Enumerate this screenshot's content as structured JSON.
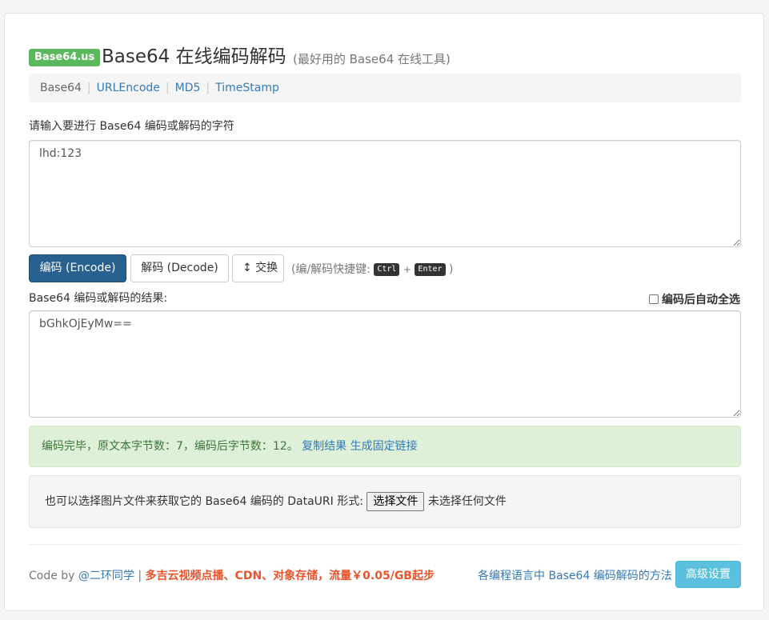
{
  "brand": "Base64.us",
  "title": "Base64 在线编码解码",
  "subtitle": "(最好用的 Base64 在线工具)",
  "nav": {
    "items": [
      {
        "label": "Base64",
        "active": true
      },
      {
        "label": "URLEncode",
        "active": false
      },
      {
        "label": "MD5",
        "active": false
      },
      {
        "label": "TimeStamp",
        "active": false
      }
    ],
    "separator": "|"
  },
  "input": {
    "label": "请输入要进行 Base64 编码或解码的字符",
    "value": "lhd:123"
  },
  "buttons": {
    "encode": "编码 (Encode)",
    "decode": "解码 (Decode)",
    "swap": "↕ 交换"
  },
  "shortcut": {
    "prefix": "(编/解码快捷键:",
    "key1": "Ctrl",
    "plus": "+",
    "key2": "Enter",
    "suffix": ")"
  },
  "output": {
    "label": "Base64 编码或解码的结果:",
    "value": "bGhkOjEyMw==",
    "auto_select_label": "编码后自动全选",
    "auto_select_checked": false
  },
  "status": {
    "message": "编码完毕，原文本字节数：7，编码后字节数：12。",
    "copy_link": "复制结果",
    "fixed_link": "生成固定链接"
  },
  "file": {
    "text": "也可以选择图片文件来获取它的 Base64 编码的 DataURI 形式:",
    "button": "选择文件",
    "no_file": "未选择任何文件"
  },
  "footer": {
    "code_by": "Code by",
    "author": "@二环同学",
    "separator": "|",
    "promo": "多吉云视频点播、CDN、对象存储，流量￥0.05/GB起步",
    "methods_link": "各编程语言中 Base64 编码解码的方法",
    "advanced_button": "高级设置"
  },
  "colors": {
    "brand_green": "#5cb85c",
    "primary": "#286090",
    "link": "#337ab7",
    "success_bg": "#dff0d8",
    "promo": "#e8542c",
    "info": "#5bc0de"
  }
}
